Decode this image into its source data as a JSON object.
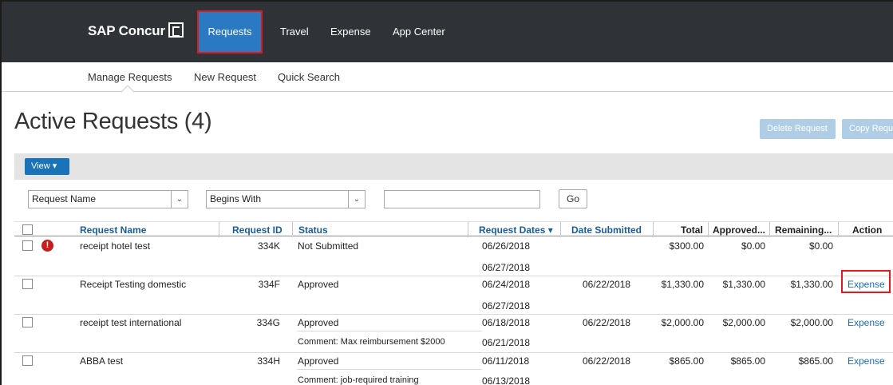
{
  "app": {
    "logo_text": "SAP Concur"
  },
  "topnav": {
    "requests": "Requests",
    "travel": "Travel",
    "expense": "Expense",
    "app_center": "App Center"
  },
  "subnav": {
    "manage": "Manage Requests",
    "new": "New Request",
    "quick": "Quick Search"
  },
  "page": {
    "title": "Active Requests (4)",
    "delete_button": "Delete Request",
    "copy_button": "Copy Requ"
  },
  "toolbar": {
    "view_label": "View ▾"
  },
  "filter": {
    "field_value": "Request Name",
    "operator_value": "Begins With",
    "search_value": "",
    "go_label": "Go"
  },
  "table": {
    "headers": {
      "name": "Request Name",
      "id": "Request ID",
      "status": "Status",
      "dates": "Request Dates ▾",
      "submitted": "Date Submitted",
      "total": "Total",
      "approved": "Approved...",
      "remaining": "Remaining...",
      "action": "Action"
    },
    "rows": [
      {
        "name": "receipt hotel test",
        "id": "334K",
        "status": "Not Submitted",
        "comment": "",
        "date_start": "06/26/2018",
        "date_end": "06/27/2018",
        "submitted": "",
        "total": "$300.00",
        "approved": "$0.00",
        "remaining": "$0.00",
        "action": "",
        "warning": "!"
      },
      {
        "name": "Receipt Testing domestic",
        "id": "334F",
        "status": "Approved",
        "comment": "",
        "date_start": "06/24/2018",
        "date_end": "06/27/2018",
        "submitted": "06/22/2018",
        "total": "$1,330.00",
        "approved": "$1,330.00",
        "remaining": "$1,330.00",
        "action": "Expense",
        "warning": ""
      },
      {
        "name": "receipt test international",
        "id": "334G",
        "status": "Approved",
        "comment": "Comment: Max reimbursement $2000",
        "date_start": "06/18/2018",
        "date_end": "06/21/2018",
        "submitted": "06/22/2018",
        "total": "$2,000.00",
        "approved": "$2,000.00",
        "remaining": "$2,000.00",
        "action": "Expense",
        "warning": ""
      },
      {
        "name": "ABBA test",
        "id": "334H",
        "status": "Approved",
        "comment": "Comment: job-required training",
        "date_start": "06/11/2018",
        "date_end": "06/13/2018",
        "submitted": "06/22/2018",
        "total": "$865.00",
        "approved": "$865.00",
        "remaining": "$865.00",
        "action": "Expense",
        "warning": ""
      }
    ]
  }
}
